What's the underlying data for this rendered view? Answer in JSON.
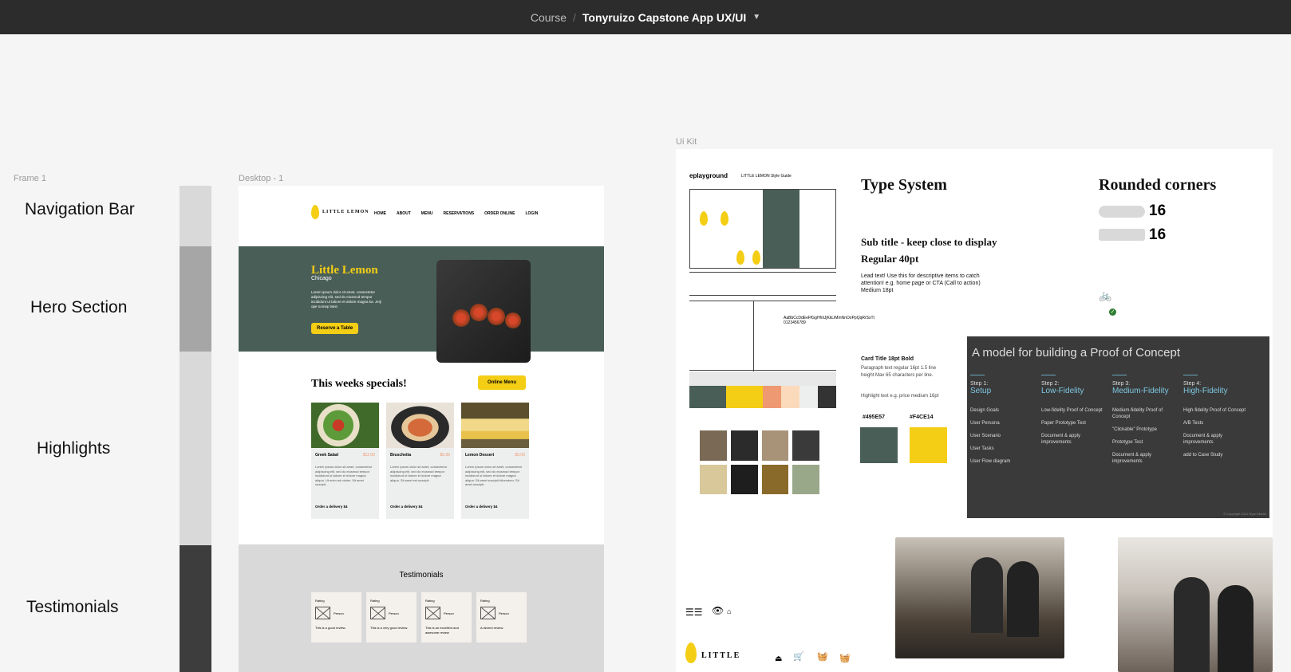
{
  "topbar": {
    "crumb_parent": "Course",
    "separator": "/",
    "file_name": "Tonyruizo Capstone App UX/UI"
  },
  "frames": {
    "frame1": "Frame 1",
    "desktop": "Desktop - 1",
    "uikit": "Ui Kit"
  },
  "sections": [
    "Navigation Bar",
    "Hero Section",
    "Highlights",
    "Testimonials"
  ],
  "desktop": {
    "logo": "LITTLE LEMON",
    "menu": [
      "HOME",
      "ABOUT",
      "MENU",
      "RESERVATIONS",
      "ORDER ONLINE",
      "LOGIN"
    ],
    "hero": {
      "title": "Little Lemon",
      "city": "Chicago",
      "desc": "Lorem ipsum dolor sit amet, consectetur adipiscing elit, sed do eiusmod tempor incididunt ut labore et dolore magna ka. Jerji ope nomep twist",
      "button": "Reserve a Table"
    },
    "specials_title": "This weeks specials!",
    "online_menu": "Online Menu",
    "cards": [
      {
        "title": "Greek Salad",
        "price": "$12.00",
        "desc": "Lorem ipsum dolor sit amet, consectetur adipiscing elit, sed do eiusmod tempor incididunt ut labore et dolore magna aliqua. Ut enim ad minim. Sit amet suscipit.",
        "order": "Order a delivery $4"
      },
      {
        "title": "Bruschetta",
        "price": "$5.99",
        "desc": "Lorem ipsum dolor sit amet, consectetur adipiscing elit, sed do eiusmod tempor incididunt ut labore et dolore magna aliqua. Sit amet est suscipit.",
        "order": "Order a delivery $4"
      },
      {
        "title": "Lemon Dessert",
        "price": "$5.00",
        "desc": "Lorem ipsum dolor sit amet, consectetur adipiscing elit, sed do eiusmod tempor incididunt ut labore et dolore magna aliqua. Sit amet suscipit bibendum. Sit amet suscipit.",
        "order": "Order a delivery $4"
      }
    ],
    "testimonials_title": "Testimonials",
    "testimonials": [
      {
        "rating": "Rating",
        "person": "Person",
        "review": "This is a good review."
      },
      {
        "rating": "Rating",
        "person": "Person",
        "review": "This is a very good review."
      },
      {
        "rating": "Rating",
        "person": "Person",
        "review": "This is an excellent and awesome review"
      },
      {
        "rating": "Rating",
        "person": "Person",
        "review": "A decent review."
      }
    ]
  },
  "uikit": {
    "styleguide_brand": "eplayground",
    "styleguide_caption": "LITTLE LEMON Style Guide",
    "type_system": "Type System",
    "subtitle": "Sub title - keep close to display",
    "regular": "Regular 40pt",
    "lead": "Lead text! Use this for descriptive items to catch attention! e.g. home page or CTA (Call to action) Medium 18pt",
    "card_title": "Card Title 18pt Bold",
    "para": "Paragraph text regular 16pt 1.5 line height Max 65 characters per line.",
    "highlight": "Highlight text e.g. price medium 16pt",
    "color1_label": "#495E57",
    "color2_label": "#F4CE14",
    "color1": "#495e57",
    "color2": "#f4ce14",
    "rounded": "Rounded corners",
    "r1": "16",
    "r2": "16",
    "model_title": "A model for building a Proof of Concept",
    "steps": [
      {
        "n": "Step 1:",
        "name": "Setup",
        "items": [
          "Design Goals",
          "User Persona",
          "User Scenario",
          "User Tasks",
          "User Flow diagram"
        ]
      },
      {
        "n": "Step 2:",
        "name": "Low-Fidelity",
        "items": [
          "Low-fidelity Proof of Concept",
          "Paper Prototype Test",
          "Document & apply improvements"
        ]
      },
      {
        "n": "Step 3:",
        "name": "Medium-Fidelity",
        "items": [
          "Medium-fidelity Proof of Concept",
          "\"Clickable\" Prototype",
          "Prototype Test",
          "Document & apply improvements"
        ]
      },
      {
        "n": "Step 4:",
        "name": "High-Fidelity",
        "items": [
          "High-fidelity Proof of Concept",
          "A/B Tests",
          "Document & apply improvements",
          "add to Case Study"
        ]
      }
    ],
    "copyright": "© Copyright 2021 Ryan Martin",
    "logo_word": "LITTLE"
  }
}
